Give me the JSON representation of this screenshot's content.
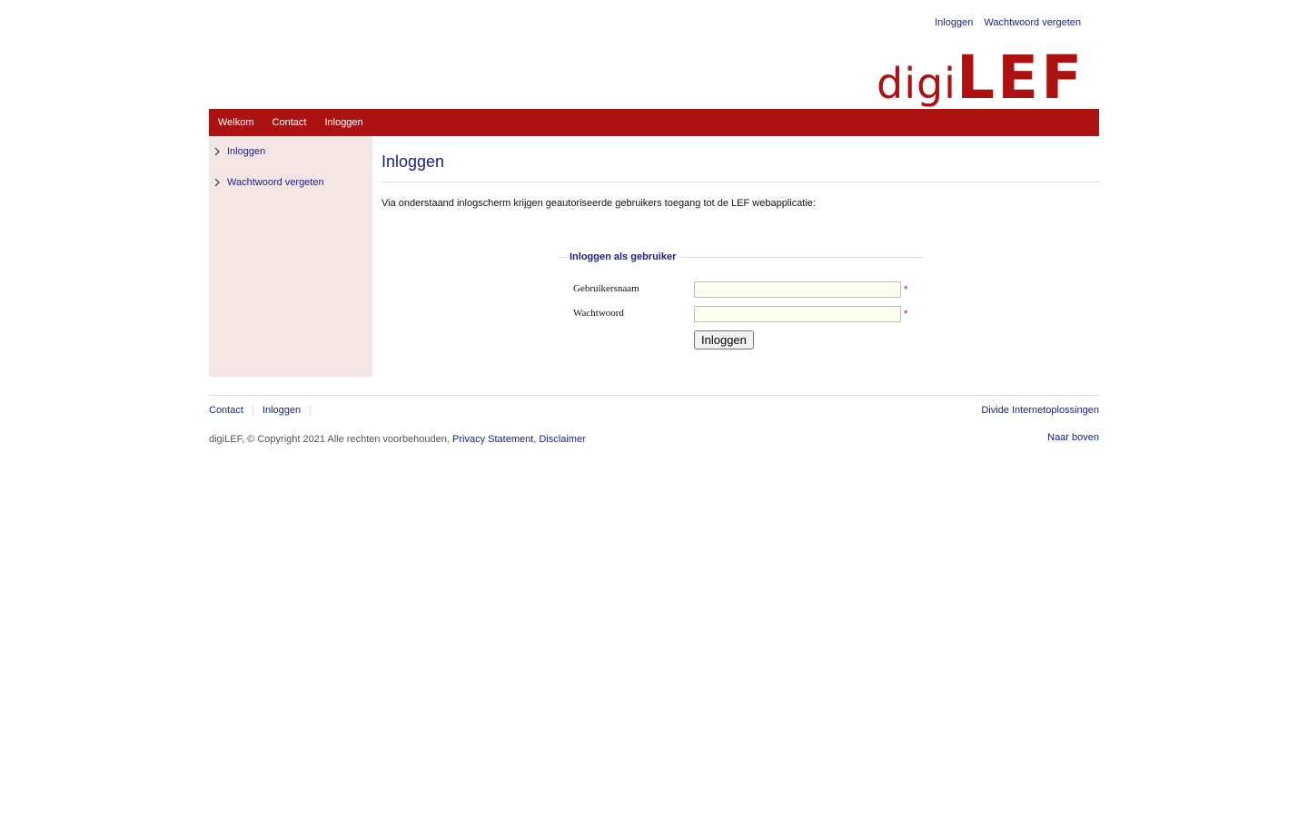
{
  "header": {
    "toplinks": [
      "Inloggen",
      "Wachtwoord vergeten"
    ],
    "logo": {
      "part1": "digi",
      "part2": "LEF"
    }
  },
  "navbar": {
    "items": [
      "Welkom",
      "Contact",
      "Inloggen"
    ],
    "color": "#ad1212"
  },
  "sidebar": {
    "items": [
      {
        "label": "Inloggen"
      },
      {
        "label": "Wachtwoord vergeten"
      }
    ],
    "background": "#f5e6e6"
  },
  "main": {
    "title": "Inloggen",
    "intro": "Via onderstaand inlogscherm krijgen geautoriseerde gebruikers toegang tot de LEF webapplicatie:",
    "form": {
      "legend": "Inloggen als gebruiker",
      "username_label": "Gebruikersnaam",
      "username_value": "",
      "password_label": "Wachtwoord",
      "password_value": "",
      "required_marker": "*",
      "submit_label": "Inloggen"
    }
  },
  "footer": {
    "links": [
      "Contact",
      "Inloggen"
    ],
    "company": "Divide Internetoplossingen",
    "copyright": "digiLEF, © Copyright 2021 Alle rechten voorbehouden,",
    "privacy": "Privacy Statement",
    "separator": ",",
    "disclaimer": "Disclaimer",
    "to_top": "Naar boven"
  }
}
